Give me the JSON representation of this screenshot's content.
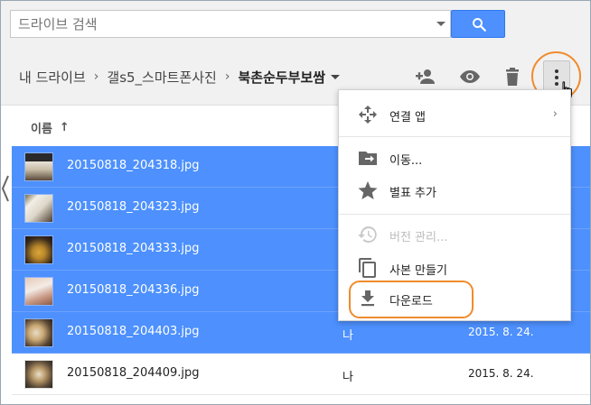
{
  "search": {
    "placeholder": "드라이브 검색"
  },
  "breadcrumb": {
    "items": [
      "내 드라이브",
      "갤s5_스마트폰사진"
    ],
    "current": "북촌순두부보쌈",
    "separator": "›"
  },
  "toolbar": {
    "icons": [
      "add-person-icon",
      "eye-icon",
      "trash-icon",
      "more-vert-icon"
    ]
  },
  "list": {
    "name_header": "이름",
    "sort_arrow": "↑",
    "rows": [
      {
        "name": "20150818_204318.jpg",
        "owner": "",
        "date": "",
        "selected": true
      },
      {
        "name": "20150818_204323.jpg",
        "owner": "",
        "date": "",
        "selected": true
      },
      {
        "name": "20150818_204333.jpg",
        "owner": "",
        "date": "",
        "selected": true
      },
      {
        "name": "20150818_204336.jpg",
        "owner": "",
        "date": "",
        "selected": true
      },
      {
        "name": "20150818_204403.jpg",
        "owner": "나",
        "date": "2015. 8. 24.",
        "selected": true
      },
      {
        "name": "20150818_204409.jpg",
        "owner": "나",
        "date": "2015. 8. 24.",
        "selected": false
      }
    ]
  },
  "menu": {
    "items": [
      {
        "label": "연결 앱",
        "icon": "move-arrows-icon",
        "submenu": "›",
        "disabled": false
      },
      {
        "label": "이동...",
        "icon": "folder-move-icon",
        "disabled": false
      },
      {
        "label": "별표 추가",
        "icon": "star-icon",
        "disabled": false
      },
      {
        "label": "버전 관리...",
        "icon": "history-icon",
        "disabled": true
      },
      {
        "label": "사본 만들기",
        "icon": "copy-icon",
        "disabled": false
      },
      {
        "label": "다운로드",
        "icon": "download-icon",
        "disabled": false
      }
    ]
  },
  "colors": {
    "accent": "#4d90fe",
    "highlight_ring": "#f08b2c",
    "toolbar_bg": "#f1f1f1"
  }
}
